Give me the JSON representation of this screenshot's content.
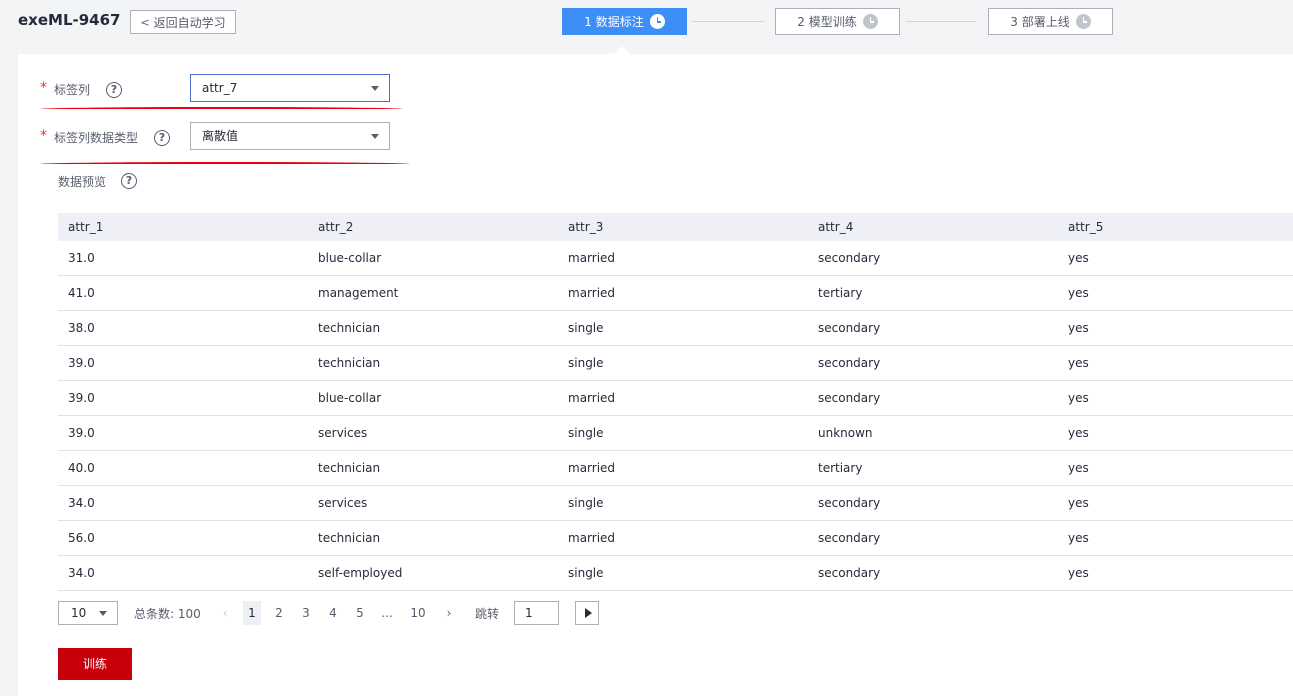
{
  "header": {
    "title": "exeML-9467",
    "back_label": "返回自动学习"
  },
  "steps": [
    {
      "label": "1 数据标注",
      "active": true
    },
    {
      "label": "2 模型训练",
      "active": false
    },
    {
      "label": "3 部署上线",
      "active": false
    }
  ],
  "form": {
    "label_column": {
      "label": "标签列",
      "value": "attr_7"
    },
    "label_type": {
      "label": "标签列数据类型",
      "value": "离散值"
    },
    "preview_label": "数据预览"
  },
  "table": {
    "columns": [
      "attr_1",
      "attr_2",
      "attr_3",
      "attr_4",
      "attr_5"
    ],
    "rows": [
      [
        "31.0",
        "blue-collar",
        "married",
        "secondary",
        "yes"
      ],
      [
        "41.0",
        "management",
        "married",
        "tertiary",
        "yes"
      ],
      [
        "38.0",
        "technician",
        "single",
        "secondary",
        "yes"
      ],
      [
        "39.0",
        "technician",
        "single",
        "secondary",
        "yes"
      ],
      [
        "39.0",
        "blue-collar",
        "married",
        "secondary",
        "yes"
      ],
      [
        "39.0",
        "services",
        "single",
        "unknown",
        "yes"
      ],
      [
        "40.0",
        "technician",
        "married",
        "tertiary",
        "yes"
      ],
      [
        "34.0",
        "services",
        "single",
        "secondary",
        "yes"
      ],
      [
        "56.0",
        "technician",
        "married",
        "secondary",
        "yes"
      ],
      [
        "34.0",
        "self-employed",
        "single",
        "secondary",
        "yes"
      ]
    ]
  },
  "pagination": {
    "page_size": "10",
    "total": "总条数: 100",
    "prev": "‹",
    "pages": [
      "1",
      "2",
      "3",
      "4",
      "5",
      "...",
      "10"
    ],
    "next": "›",
    "jump_label": "跳转",
    "jump_value": "1"
  },
  "train_label": "训练",
  "colors": {
    "accent": "#3e8ef7",
    "danger": "#c7000b",
    "annotation": "#e8000b"
  }
}
